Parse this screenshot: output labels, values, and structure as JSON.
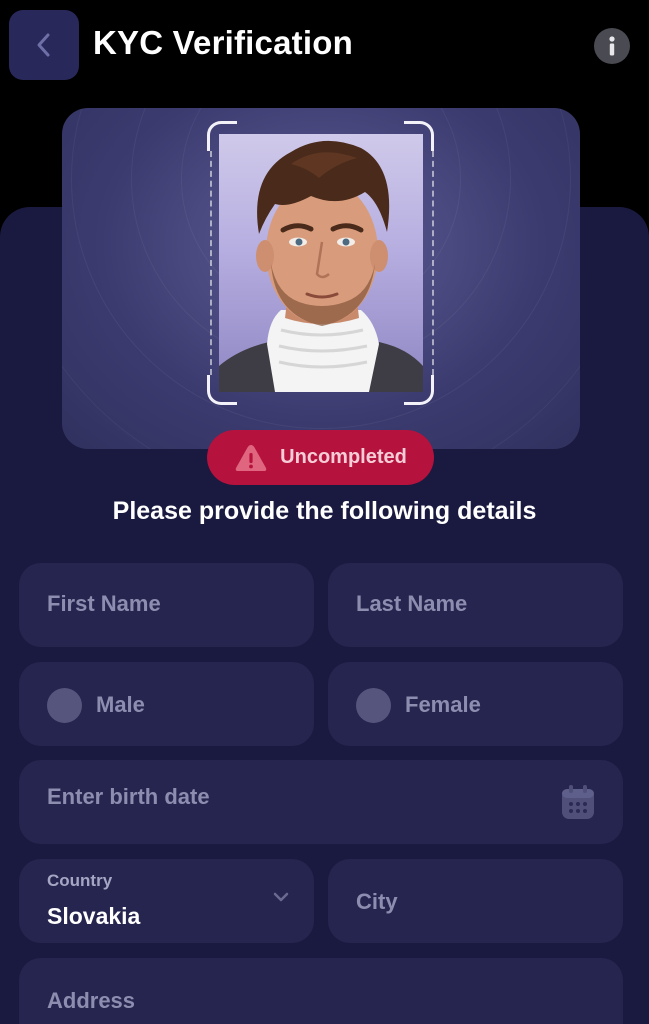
{
  "header": {
    "title": "KYC Verification",
    "back_icon": "chevron-left-icon",
    "info_icon": "info-icon"
  },
  "photo": {
    "subject": "portrait photo",
    "status_label": "Uncompleted",
    "status_icon": "warning-icon",
    "status_color": "#b5123d"
  },
  "form": {
    "prompt": "Please provide the following details",
    "first_name_placeholder": "First Name",
    "last_name_placeholder": "Last Name",
    "gender_male": "Male",
    "gender_female": "Female",
    "birth_date_placeholder": "Enter birth date",
    "country_label": "Country",
    "country_value": "Slovakia",
    "city_placeholder": "City",
    "address_placeholder": "Address"
  },
  "colors": {
    "background": "#000000",
    "panel": "#1a1a40",
    "field": "#25254f",
    "accent_button": "#28285a",
    "error": "#b5123d"
  }
}
